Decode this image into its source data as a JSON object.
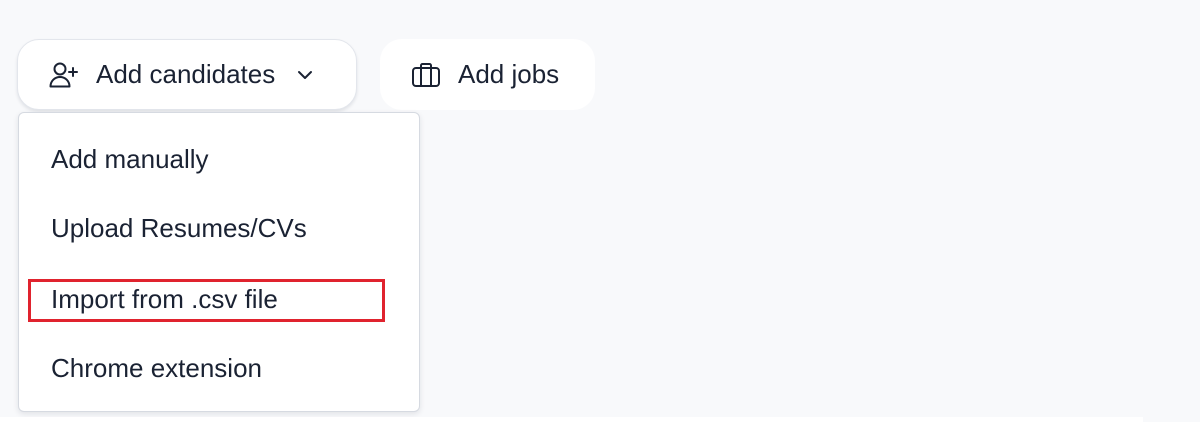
{
  "toolbar": {
    "add_candidates_label": "Add candidates",
    "add_jobs_label": "Add jobs",
    "icons": {
      "add_candidates": "user-plus-icon",
      "add_jobs": "briefcase-icon",
      "dropdown_arrow": "chevron-down-icon"
    }
  },
  "dropdown": {
    "items": [
      {
        "label": "Add manually"
      },
      {
        "label": "Upload Resumes/CVs"
      },
      {
        "label": "Import from .csv file",
        "highlighted": true
      },
      {
        "label": "Chrome extension"
      }
    ]
  },
  "colors": {
    "background": "#f8f9fb",
    "text": "#1a2233",
    "highlight_outline": "#e0232e",
    "surface": "#ffffff"
  }
}
